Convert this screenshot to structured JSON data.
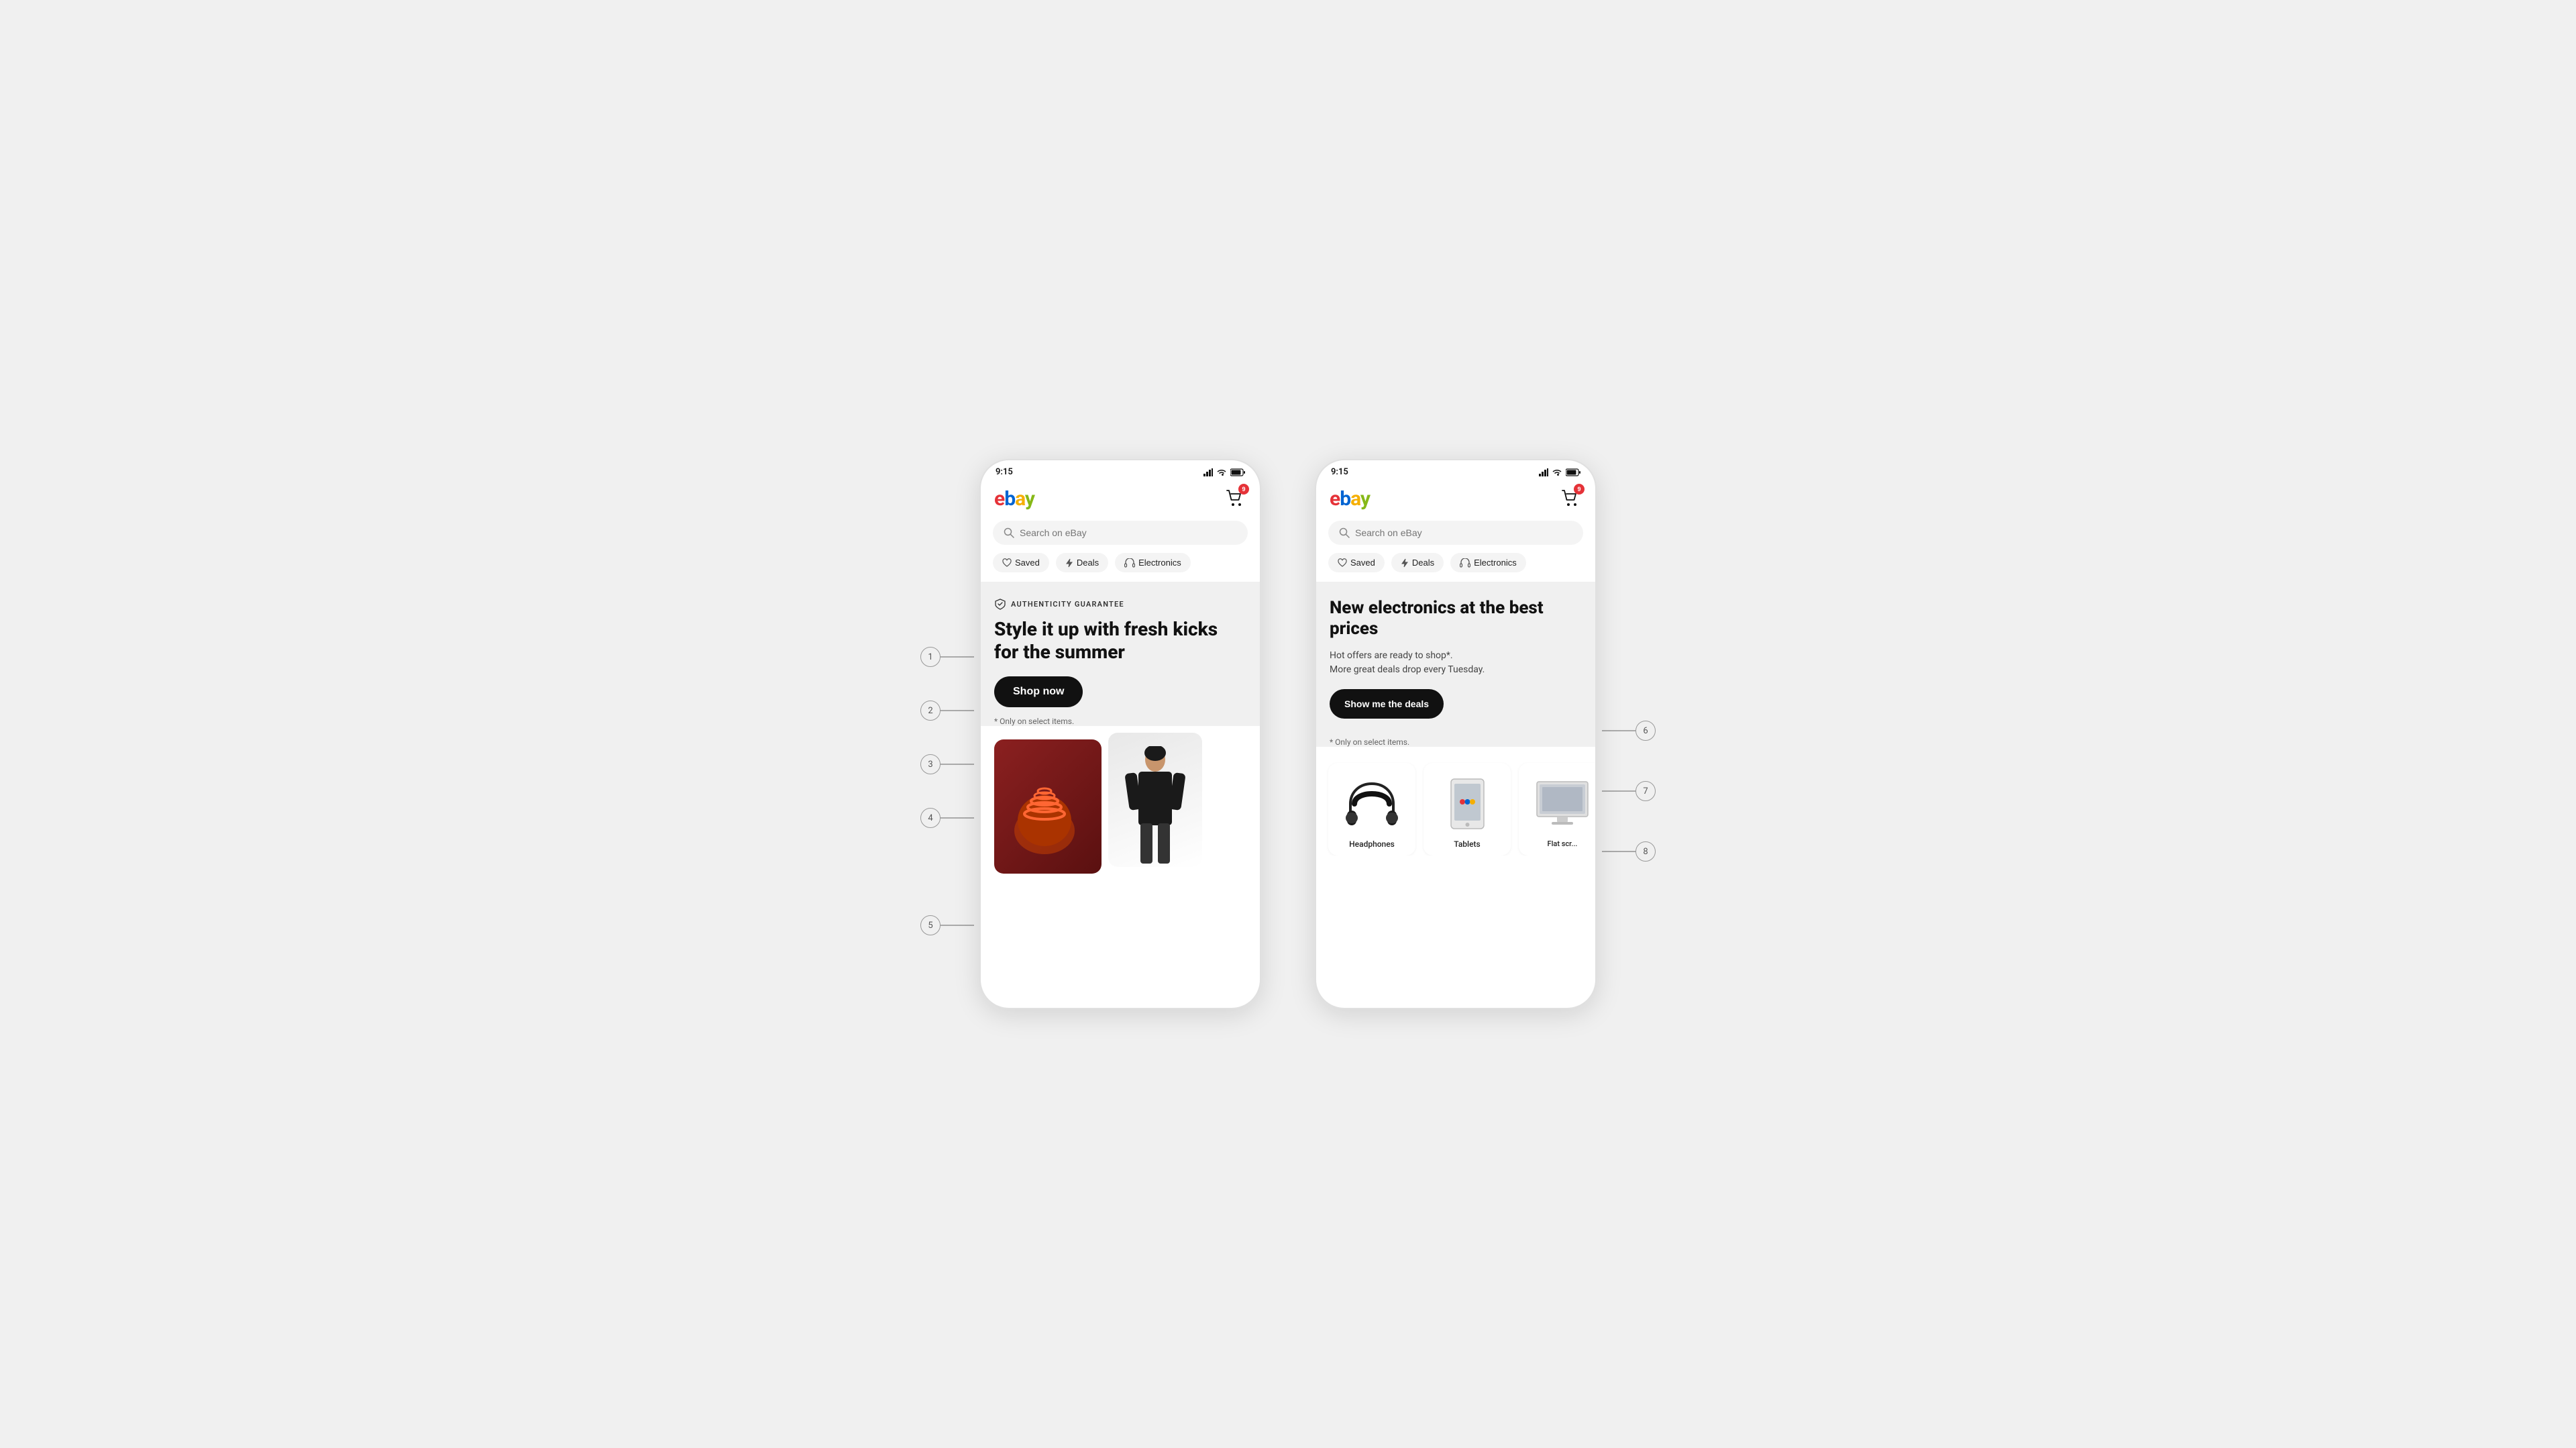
{
  "page": {
    "background": "#f0f0f0"
  },
  "phone1": {
    "status_time": "9:15",
    "cart_badge": "9",
    "search_placeholder": "Search on eBay",
    "quick_links": [
      {
        "label": "Saved",
        "icon": "heart"
      },
      {
        "label": "Deals",
        "icon": "bolt"
      },
      {
        "label": "Electronics",
        "icon": "headphones"
      }
    ],
    "banner": {
      "tag": "AUTHENTICITY GUARANTEE",
      "title": "Style it up with fresh kicks for the summer",
      "cta": "Shop now",
      "disclaimer": "* Only on select items."
    },
    "annotations": [
      {
        "num": "1",
        "target": "authenticity-tag"
      },
      {
        "num": "2",
        "target": "banner-title"
      },
      {
        "num": "3",
        "target": "cta-button"
      },
      {
        "num": "4",
        "target": "disclaimer"
      },
      {
        "num": "5",
        "target": "product-images"
      }
    ]
  },
  "phone2": {
    "status_time": "9:15",
    "cart_badge": "9",
    "search_placeholder": "Search on eBay",
    "quick_links": [
      {
        "label": "Saved",
        "icon": "heart"
      },
      {
        "label": "Deals",
        "icon": "bolt"
      },
      {
        "label": "Electronics",
        "icon": "headphones"
      }
    ],
    "banner": {
      "title": "New electronics at the best prices",
      "description_line1": "Hot offers are ready to shop*.",
      "description_line2": "More great deals drop every Tuesday.",
      "cta": "Show me the deals",
      "disclaimer": "* Only on select items."
    },
    "products": [
      {
        "label": "Headphones"
      },
      {
        "label": "Tablets"
      },
      {
        "label": "Flat scr..."
      }
    ],
    "annotations": [
      {
        "num": "6",
        "target": "banner-desc"
      },
      {
        "num": "7",
        "target": "product-cards"
      },
      {
        "num": "8",
        "target": "product-labels"
      }
    ]
  }
}
